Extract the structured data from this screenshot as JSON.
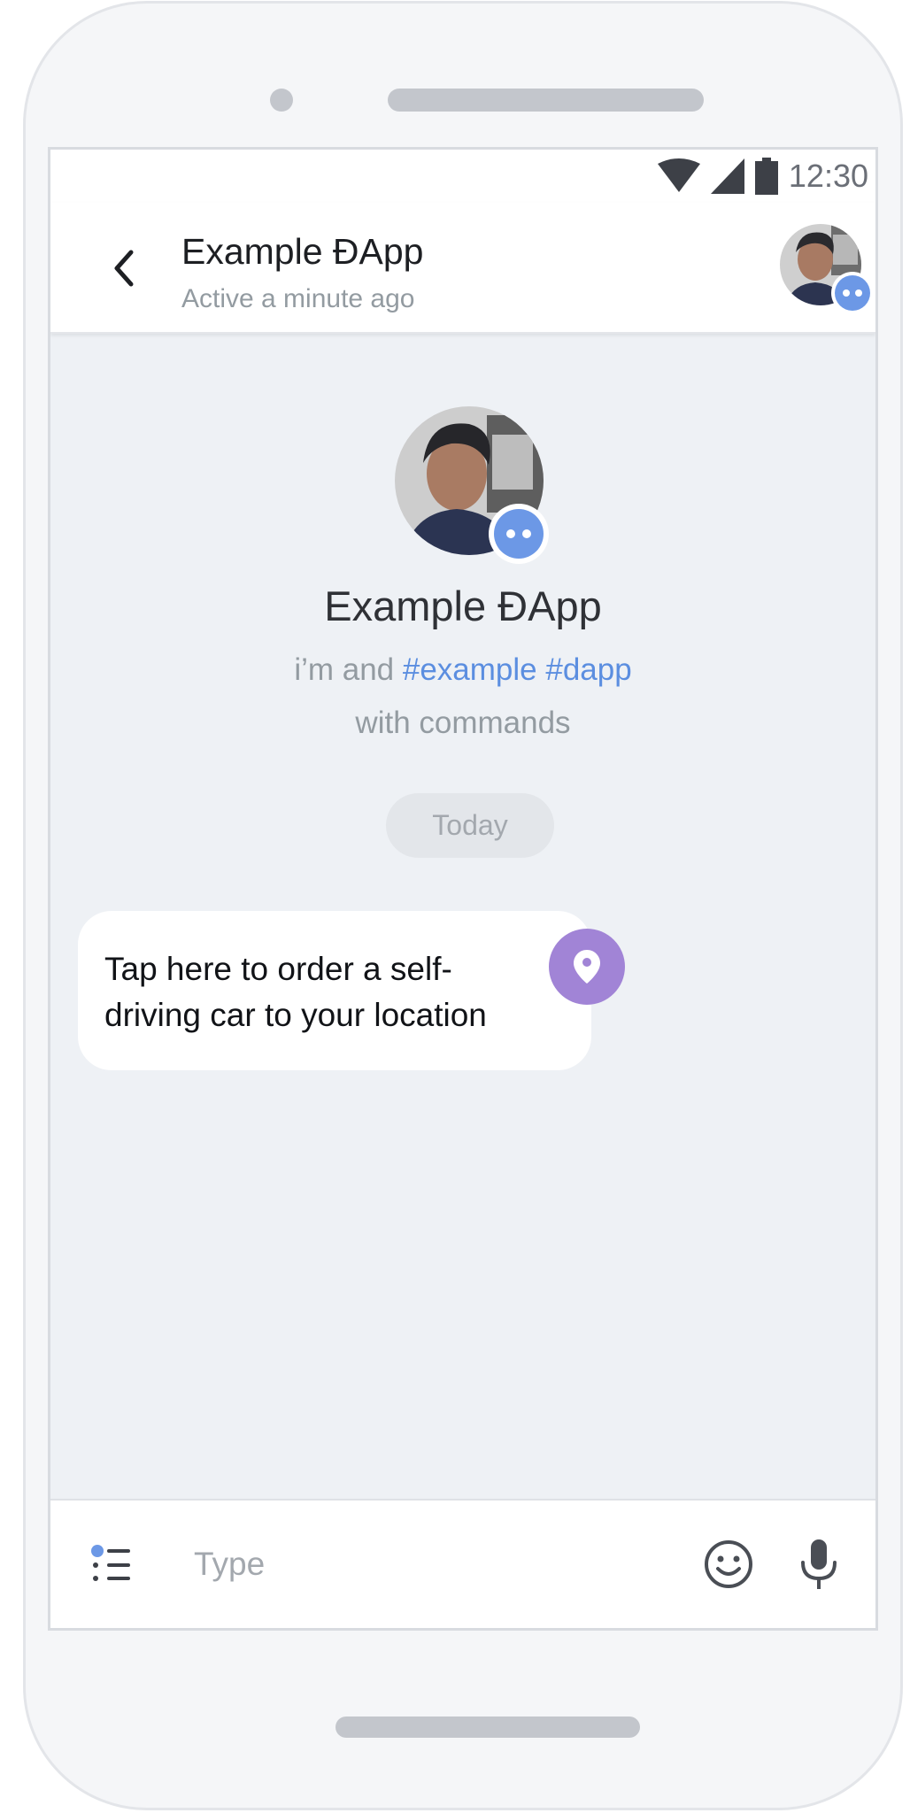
{
  "status_bar": {
    "time": "12:30",
    "icons": [
      "wifi-icon",
      "signal-icon",
      "battery-icon"
    ]
  },
  "header": {
    "title": "Example ĐApp",
    "subtitle": "Active a minute ago",
    "back_icon": "chevron-left-icon"
  },
  "profile": {
    "name": "Example ĐApp",
    "description_prefix": "i’m and ",
    "tags": "#example #dapp",
    "description_suffix": "with commands"
  },
  "chat": {
    "date_label": "Today",
    "messages": [
      {
        "text": "Tap here to order a self-driving car to your location",
        "icon": "location-pin-icon"
      }
    ]
  },
  "input_bar": {
    "placeholder": "Type",
    "icons": [
      "commands-icon",
      "emoji-icon",
      "microphone-icon"
    ]
  },
  "colors": {
    "accent": "#5b8ee0",
    "bot_badge": "#6c98e6",
    "location_button": "#a184d6",
    "chat_background": "#eef1f5",
    "secondary_text": "#939ba1"
  }
}
